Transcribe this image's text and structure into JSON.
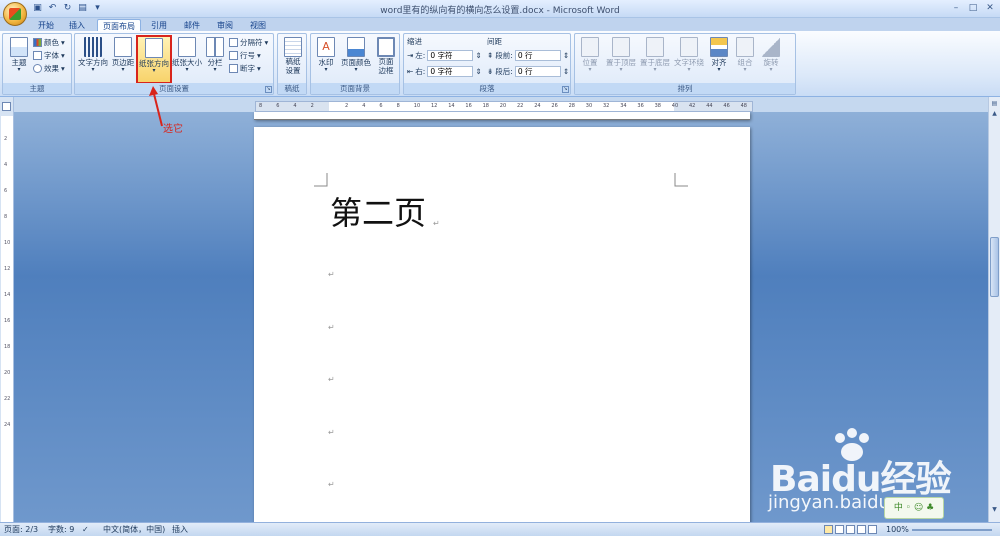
{
  "window": {
    "title": "word里有的纵向有的横向怎么设置.docx - Microsoft Word"
  },
  "tabs": [
    "开始",
    "插入",
    "页面布局",
    "引用",
    "邮件",
    "审阅",
    "视图"
  ],
  "active_tab": "页面布局",
  "ribbon": {
    "theme": {
      "themes_label": "主题",
      "colors_label": "颜色",
      "fonts_label": "字体",
      "effects_label": "效果",
      "group_label": "主题"
    },
    "page_setup": {
      "text_direction_label": "文字方向",
      "margins_label": "页边距",
      "orientation_label": "纸张方向",
      "size_label": "纸张大小",
      "columns_label": "分栏",
      "breaks_label": "分隔符",
      "line_numbers_label": "行号",
      "hyphenation_label": "断字",
      "group_label": "页面设置"
    },
    "manuscript": {
      "setup_label": "稿纸设置",
      "group_label": "稿纸"
    },
    "page_background": {
      "watermark_label": "水印",
      "page_color_label": "页面颜色",
      "page_borders_label": "页面边框",
      "group_label": "页面背景"
    },
    "paragraph": {
      "indent_label": "缩进",
      "left_label": "左:",
      "left_value": "0 字符",
      "right_label": "右:",
      "right_value": "0 字符",
      "spacing_label": "间距",
      "before_label": "段前:",
      "before_value": "0 行",
      "after_label": "段后:",
      "after_value": "0 行",
      "group_label": "段落"
    },
    "arrange": {
      "position_label": "位置",
      "bring_front_label": "置于顶层",
      "send_back_label": "置于底层",
      "text_wrap_label": "文字环绕",
      "align_label": "对齐",
      "group_label_btn": "组合",
      "rotate_label": "旋转",
      "group_label": "排列"
    }
  },
  "annotation": {
    "text": "选它",
    "color": "#d8241b"
  },
  "ruler": {
    "h_numbers": [
      "8",
      "6",
      "4",
      "2",
      "",
      "2",
      "4",
      "6",
      "8",
      "10",
      "12",
      "14",
      "16",
      "18",
      "20",
      "22",
      "24",
      "26",
      "28",
      "30",
      "32",
      "34",
      "36",
      "38",
      "40",
      "42",
      "44",
      "46",
      "48"
    ],
    "v_numbers": [
      "2",
      "4",
      "6",
      "8",
      "10",
      "12",
      "14",
      "16",
      "18",
      "20",
      "22",
      "24"
    ]
  },
  "document": {
    "heading": "第二页",
    "paragraph_mark": "↵"
  },
  "status": {
    "page": "页面: 2/3",
    "words": "字数: 9",
    "language": "中文(简体，中国)",
    "mode": "插入",
    "zoom": "100%"
  },
  "watermark": {
    "logo": "Baidu经验",
    "url": "jingyan.baidu.com"
  }
}
